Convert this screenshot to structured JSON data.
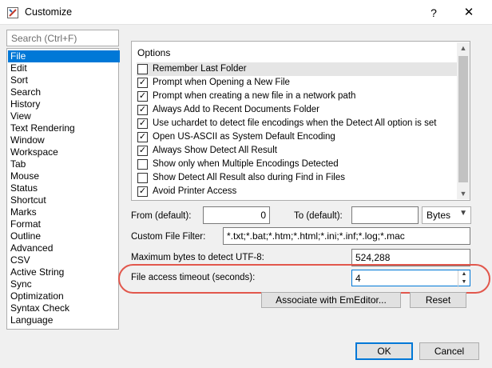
{
  "window": {
    "title": "Customize",
    "help": "?",
    "close": "✕",
    "icon": "customize-app-icon",
    "accent": "#0078d7",
    "annotation_color": "#e2574c"
  },
  "search": {
    "placeholder": "Search (Ctrl+F)"
  },
  "categories": [
    "File",
    "Edit",
    "Sort",
    "Search",
    "History",
    "View",
    "Text Rendering",
    "Window",
    "Workspace",
    "Tab",
    "Mouse",
    "Status",
    "Shortcut",
    "Marks",
    "Format",
    "Outline",
    "Advanced",
    "CSV",
    "Active String",
    "Sync",
    "Optimization",
    "Syntax Check",
    "Language"
  ],
  "selected_category": "File",
  "options": {
    "title": "Options",
    "items": [
      {
        "label": "Remember Last Folder",
        "checked": false
      },
      {
        "label": "Prompt when Opening a New File",
        "checked": true
      },
      {
        "label": "Prompt when creating a new file in a network path",
        "checked": true
      },
      {
        "label": "Always Add to Recent Documents Folder",
        "checked": true
      },
      {
        "label": "Use uchardet to detect file encodings when the Detect All option is set",
        "checked": true
      },
      {
        "label": "Open US-ASCII as System Default Encoding",
        "checked": true
      },
      {
        "label": "Always Show Detect All Result",
        "checked": true
      },
      {
        "label": "Show only when Multiple Encodings Detected",
        "checked": false
      },
      {
        "label": "Show Detect All Result also during Find in Files",
        "checked": false
      },
      {
        "label": "Avoid Printer Access",
        "checked": true
      }
    ]
  },
  "from": {
    "label": "From (default):",
    "value": "0"
  },
  "to": {
    "label": "To (default):",
    "value": ""
  },
  "unit": {
    "value": "Bytes"
  },
  "filter": {
    "label": "Custom File Filter:",
    "value": "*.txt;*.bat;*.htm;*.html;*.ini;*.inf;*.log;*.mac"
  },
  "maxbytes": {
    "label": "Maximum bytes to detect UTF-8:",
    "value": "524,288"
  },
  "timeout": {
    "label": "File access timeout (seconds):",
    "value": "4"
  },
  "buttons": {
    "associate": "Associate with EmEditor...",
    "reset": "Reset",
    "ok": "OK",
    "cancel": "Cancel"
  }
}
